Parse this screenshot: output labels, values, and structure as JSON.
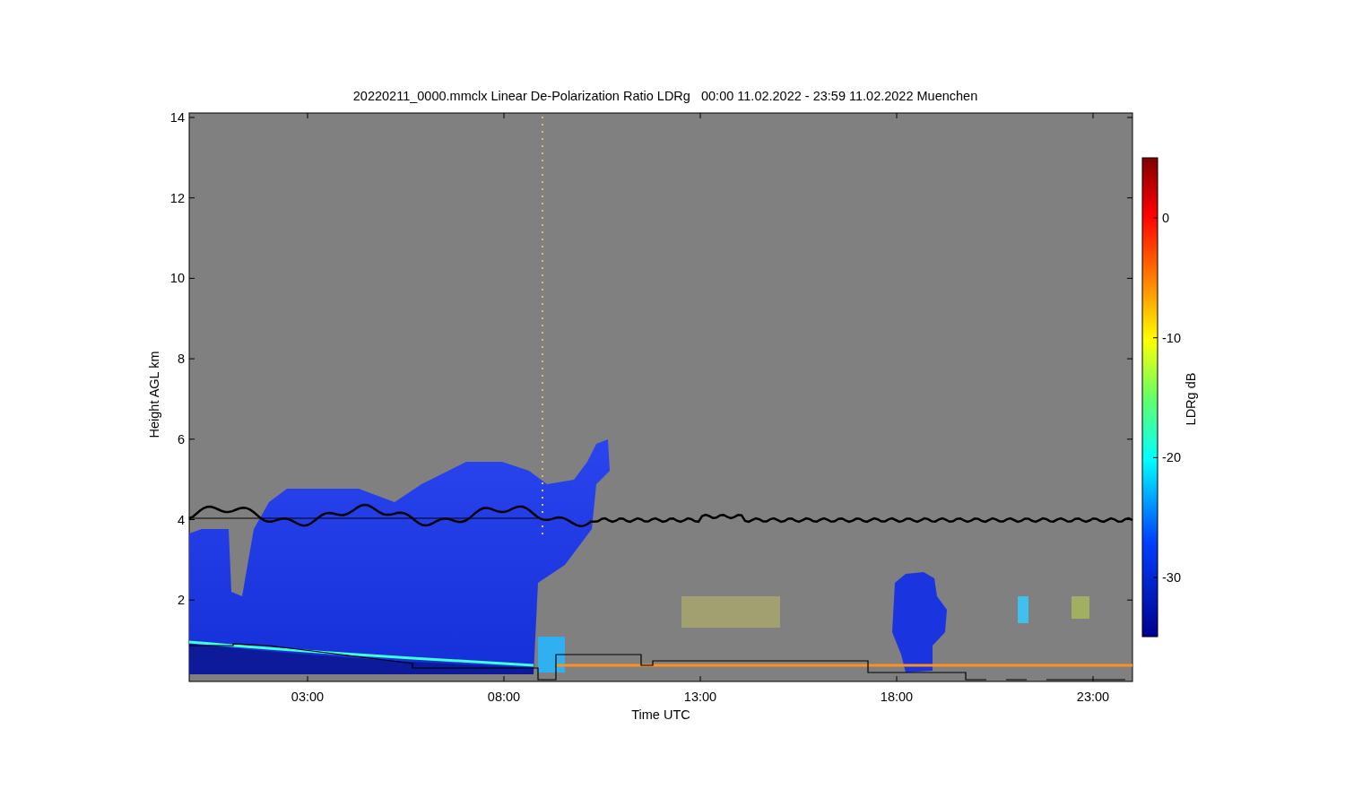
{
  "figure": {
    "title": "20220211_0000.mmclx Linear De-Polarization Ratio LDRg   00:00 11.02.2022 - 23:59 11.02.2022 Muenchen",
    "ylabel": "Height AGL km",
    "xlabel": "Time UTC",
    "yticks": [
      "14",
      "12",
      "10",
      "8",
      "6",
      "4",
      "2"
    ],
    "xticks": [
      "03:00",
      "08:00",
      "13:00",
      "18:00",
      "23:00"
    ],
    "colorbar": {
      "label": "LDRg dB",
      "ticks": [
        "0",
        "-10",
        "-20",
        "-30"
      ]
    }
  }
}
